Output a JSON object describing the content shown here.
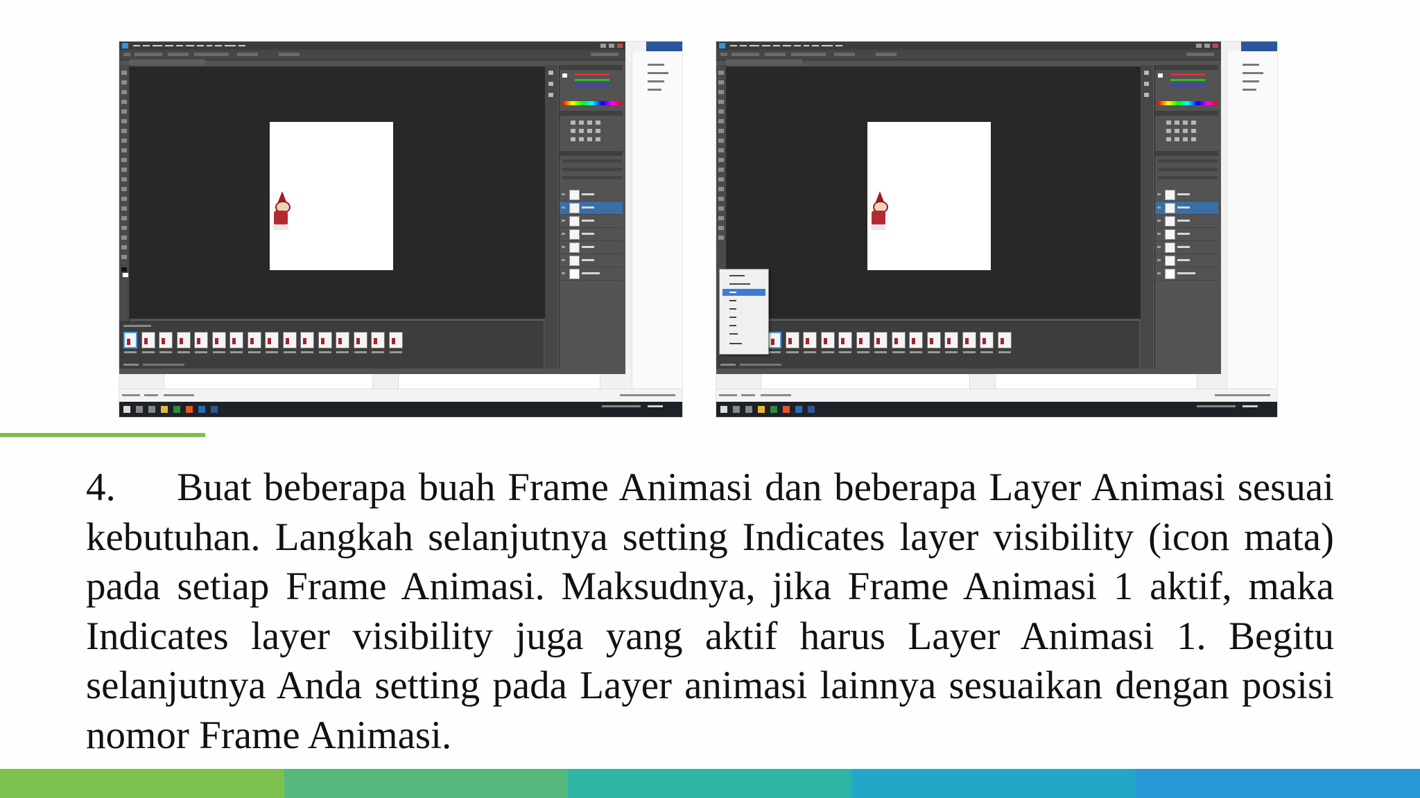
{
  "step_text": "4.     Buat beberapa buah Frame Animasi dan beberapa  Layer Animasi sesuai kebutuhan. Langkah selanjutnya setting Indicates layer visibility (icon mata) pada setiap Frame Animasi. Maksudnya, jika Frame Animasi 1 aktif, maka Indicates layer visibility juga yang aktif harus Layer Animasi 1. Begitu selanjutnya Anda setting pada Layer animasi lainnya sesuaikan dengan posisi nomor Frame Animasi.",
  "colors": {
    "accent_line": "#7cc04e",
    "bottom_bar": [
      "#7cc04e",
      "#55b97e",
      "#2db5a5",
      "#22a7c9",
      "#2699d4"
    ],
    "photoshop_bg": "#535353",
    "canvas_bg": "#282828",
    "layer_selected": "#3a6fa6"
  },
  "screenshots": [
    {
      "name": "left-screenshot",
      "state": "timeline-frames",
      "frame_count": 16,
      "layer_count": 7,
      "selected_layer_index": 1
    },
    {
      "name": "right-screenshot",
      "state": "frame-delay-menu-open",
      "frame_count": 14,
      "layer_count": 7,
      "selected_layer_index": 1
    }
  ]
}
